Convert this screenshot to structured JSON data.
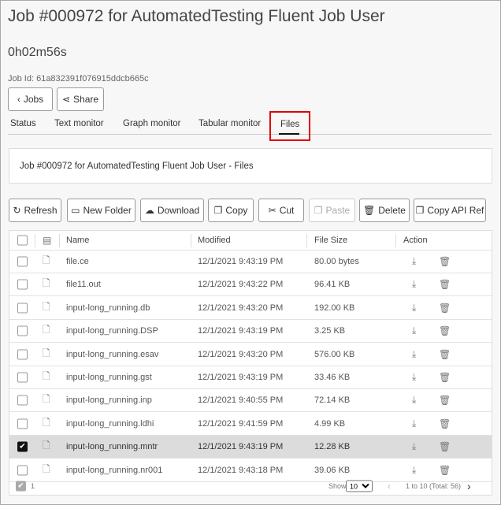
{
  "header": {
    "title": "Job #000972 for AutomatedTesting Fluent Job User",
    "elapsed": "0h02m56s",
    "job_id": "Job Id: 61a832391f076915ddcb665c",
    "jobs_button": "Jobs",
    "share_button": "Share"
  },
  "tabs": [
    "Status",
    "Text monitor",
    "Graph monitor",
    "Tabular monitor",
    "Files"
  ],
  "active_tab": "Files",
  "panel_title": "Job #000972 for AutomatedTesting Fluent Job User - Files",
  "toolbar": {
    "refresh": "Refresh",
    "new_folder": "New Folder",
    "download": "Download",
    "copy": "Copy",
    "cut": "Cut",
    "paste": "Paste",
    "delete": "Delete",
    "copy_api_ref": "Copy API Ref"
  },
  "table": {
    "headers": {
      "name": "Name",
      "modified": "Modified",
      "size": "File Size",
      "action": "Action"
    },
    "rows": [
      {
        "name": "file.ce",
        "modified": "12/1/2021 9:43:19 PM",
        "size": "80.00 bytes",
        "selected": false
      },
      {
        "name": "file11.out",
        "modified": "12/1/2021 9:43:22 PM",
        "size": "96.41 KB",
        "selected": false
      },
      {
        "name": "input-long_running.db",
        "modified": "12/1/2021 9:43:20 PM",
        "size": "192.00 KB",
        "selected": false
      },
      {
        "name": "input-long_running.DSP",
        "modified": "12/1/2021 9:43:19 PM",
        "size": "3.25 KB",
        "selected": false
      },
      {
        "name": "input-long_running.esav",
        "modified": "12/1/2021 9:43:20 PM",
        "size": "576.00 KB",
        "selected": false
      },
      {
        "name": "input-long_running.gst",
        "modified": "12/1/2021 9:43:19 PM",
        "size": "33.46 KB",
        "selected": false
      },
      {
        "name": "input-long_running.inp",
        "modified": "12/1/2021 9:40:55 PM",
        "size": "72.14 KB",
        "selected": false
      },
      {
        "name": "input-long_running.ldhi",
        "modified": "12/1/2021 9:41:59 PM",
        "size": "4.99 KB",
        "selected": false
      },
      {
        "name": "input-long_running.mntr",
        "modified": "12/1/2021 9:43:19 PM",
        "size": "12.28 KB",
        "selected": true
      },
      {
        "name": "input-long_running.nr001",
        "modified": "12/1/2021 9:43:18 PM",
        "size": "39.06 KB",
        "selected": false
      }
    ]
  },
  "footer": {
    "selected_count": "1",
    "show_label": "Show",
    "page_size": "10",
    "range": "1 to 10 (Total: 56)"
  }
}
